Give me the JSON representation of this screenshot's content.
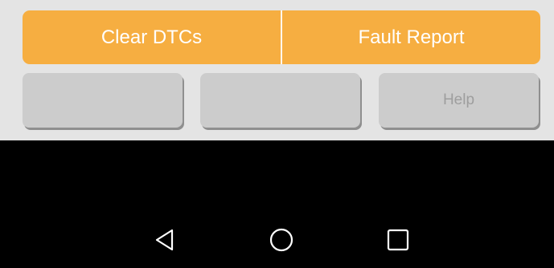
{
  "toolbar": {
    "clear_dtcs_label": "Clear DTCs",
    "fault_report_label": "Fault Report"
  },
  "secondary": {
    "button1_label": "",
    "button2_label": "",
    "help_label": "Help"
  },
  "nav": {
    "back_icon": "back-icon",
    "home_icon": "home-icon",
    "recents_icon": "recents-icon"
  },
  "colors": {
    "accent": "#f6ae41",
    "panel_background": "#e4e4e4",
    "secondary_button": "#cccccc",
    "nav_background": "#000000"
  }
}
